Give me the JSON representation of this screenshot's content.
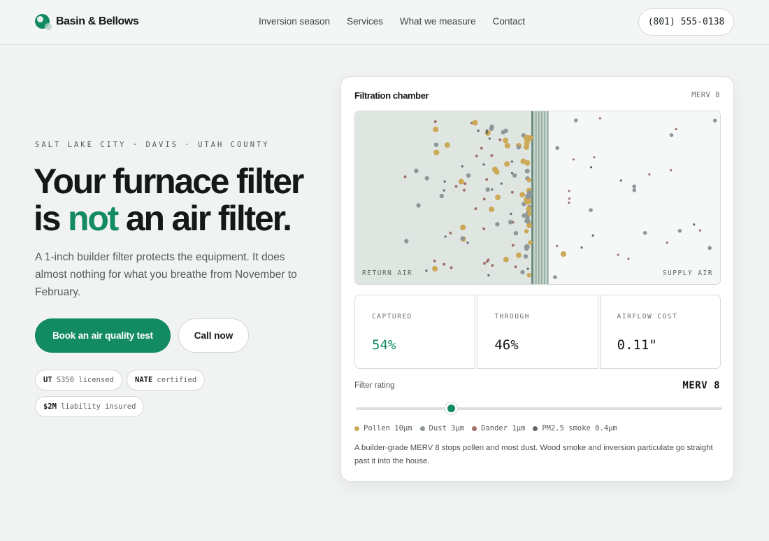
{
  "brand": {
    "name": "Basin & Bellows",
    "logo_icon": "droplet-logo-icon"
  },
  "nav": {
    "items": [
      "Inversion season",
      "Services",
      "What we measure",
      "Contact"
    ]
  },
  "header": {
    "phone": "(801) 555-0138"
  },
  "hero": {
    "eyebrow": "SALT LAKE CITY · DAVIS · UTAH COUNTY",
    "headline_line1": "Your furnace filter",
    "headline_pre": "is ",
    "headline_accent": "not",
    "headline_post": " an air filter.",
    "lede": "A 1-inch builder filter protects the equipment. It does almost nothing for what you breathe from November to February.",
    "primary_cta": "Book an air quality test",
    "secondary_cta": "Call now",
    "badges": [
      {
        "strong": "UT",
        "text": "S350 licensed"
      },
      {
        "strong": "NATE",
        "text": "certified"
      },
      {
        "strong": "$2M",
        "text": "liability insured"
      }
    ]
  },
  "card": {
    "title": "Filtration chamber",
    "merv_badge": "MERV 8",
    "return_label": "RETURN AIR",
    "supply_label": "SUPPLY AIR",
    "stats": [
      {
        "label": "CAPTURED",
        "value": "54%"
      },
      {
        "label": "THROUGH",
        "value": "46%"
      },
      {
        "label": "AIRFLOW COST",
        "value": "0.11\""
      }
    ],
    "rating_label": "Filter rating",
    "rating_value": "MERV 8",
    "slider_level": 0.26,
    "legend": [
      {
        "label": "Pollen 10µm",
        "color": "#cba956"
      },
      {
        "label": "Dust 3µm",
        "color": "#8f979b"
      },
      {
        "label": "Dander 1µm",
        "color": "#a1716a"
      },
      {
        "label": "PM2.5 smoke 0.4µm",
        "color": "#5f6766"
      }
    ],
    "note": "A builder-grade MERV 8 stops pollen and most dust. Wood smoke and inversion particulate go straight past it into the house."
  },
  "colors": {
    "accent": "#128a62",
    "background": "#f1f3f2",
    "chamber_left": "#dfe6e2",
    "chamber_right": "#f6f8f7"
  }
}
